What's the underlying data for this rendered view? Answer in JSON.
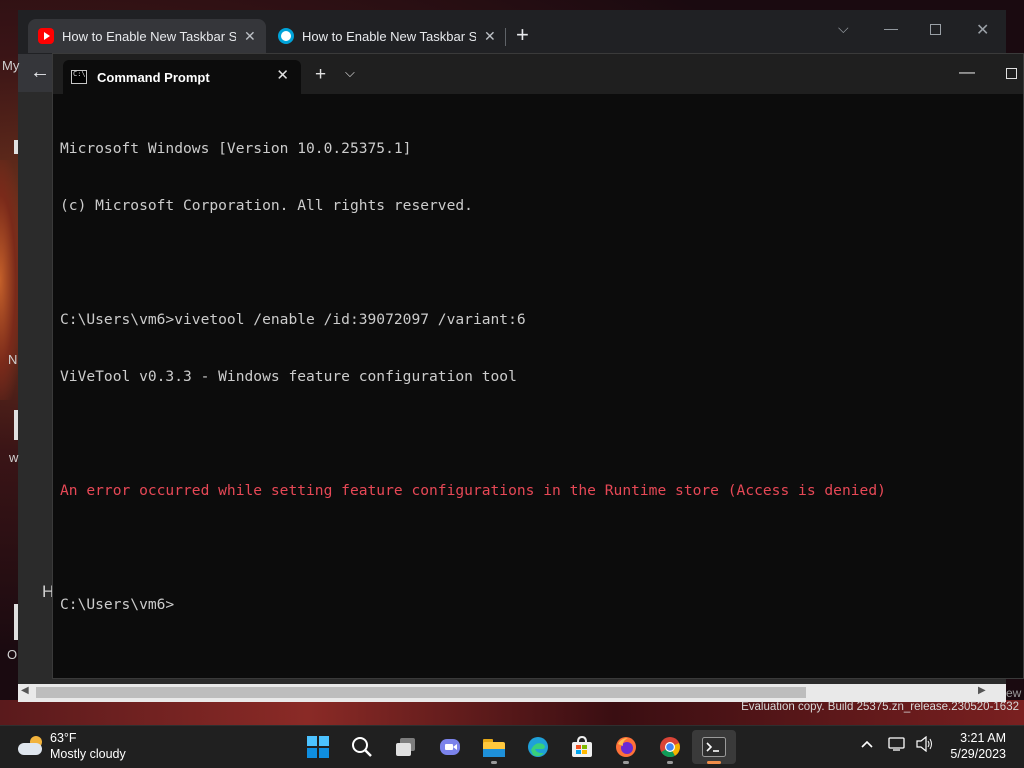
{
  "browser": {
    "tabs": [
      {
        "title": "How to Enable New Taskbar Sear",
        "icon": "youtube-icon"
      },
      {
        "title": "How to Enable New Taskbar Sear",
        "icon": "site-icon"
      }
    ],
    "side_texts": [
      "My",
      "N",
      "w",
      "H",
      "O"
    ],
    "corner_text": "ew"
  },
  "terminal": {
    "tab_title": "Command Prompt",
    "lines": [
      {
        "text": "Microsoft Windows [Version 10.0.25375.1]",
        "type": "normal"
      },
      {
        "text": "(c) Microsoft Corporation. All rights reserved.",
        "type": "normal"
      },
      {
        "text": "",
        "type": "normal"
      },
      {
        "text": "C:\\Users\\vm6>vivetool /enable /id:39072097 /variant:6",
        "type": "normal"
      },
      {
        "text": "ViVeTool v0.3.3 - Windows feature configuration tool",
        "type": "normal"
      },
      {
        "text": "",
        "type": "normal"
      },
      {
        "text": "An error occurred while setting feature configurations in the Runtime store (Access is denied)",
        "type": "error"
      },
      {
        "text": "",
        "type": "normal"
      },
      {
        "text": "C:\\Users\\vm6>",
        "type": "normal"
      }
    ],
    "colors": {
      "background": "#0c0c0c",
      "text": "#cccccc",
      "error": "#e74856"
    }
  },
  "watermark": "Evaluation copy. Build 25375.zn_release.230520-1632",
  "taskbar": {
    "weather": {
      "temp": "63°F",
      "condition": "Mostly cloudy"
    },
    "apps": [
      "start-icon",
      "search-icon",
      "task-view-icon",
      "teams-chat-icon",
      "file-explorer-icon",
      "edge-icon",
      "store-icon",
      "firefox-icon",
      "chrome-icon",
      "terminal-icon"
    ],
    "clock": {
      "time": "3:21 AM",
      "date": "5/29/2023"
    }
  }
}
